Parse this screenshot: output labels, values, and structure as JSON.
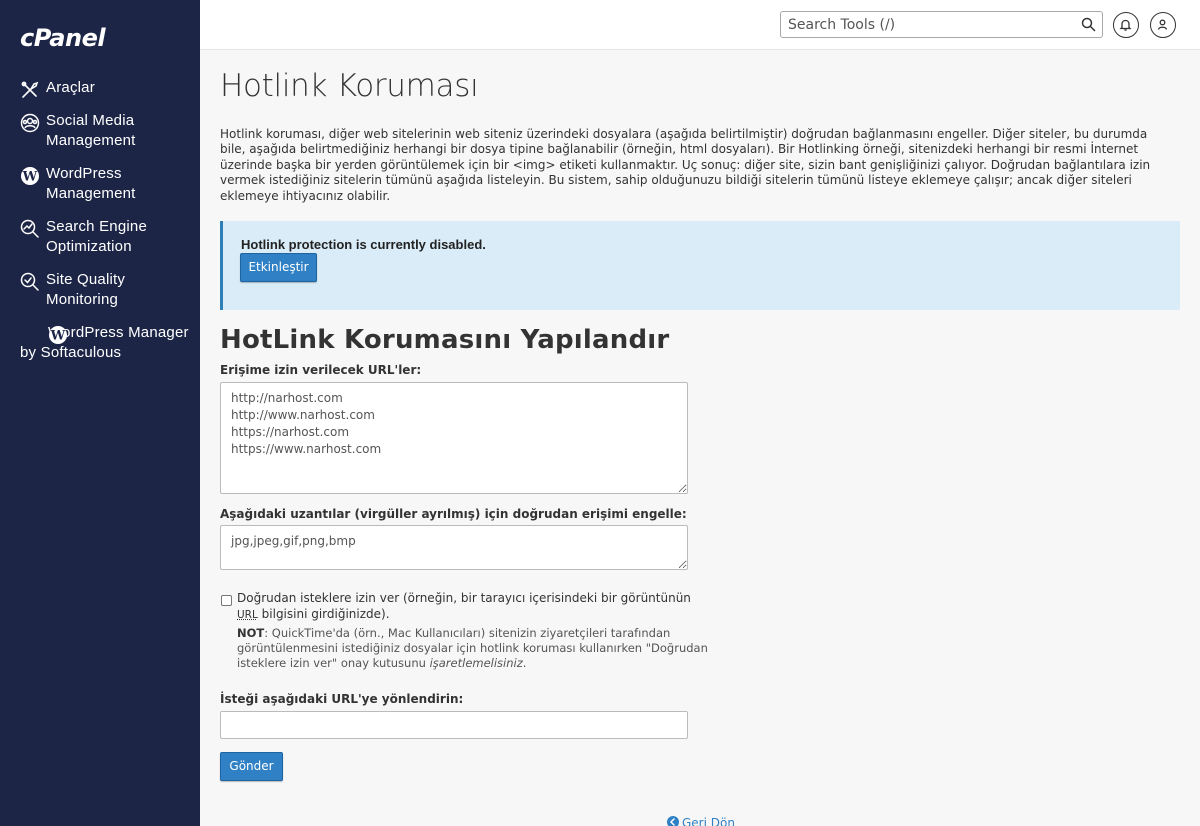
{
  "brand": {
    "logo_text": "cPanel"
  },
  "sidebar": {
    "items": [
      {
        "label": "Araçlar",
        "icon": "tools-icon"
      },
      {
        "label": "Social Media Management",
        "icon": "social-media-icon"
      },
      {
        "label": "WordPress Management",
        "icon": "wordpress-icon"
      },
      {
        "label": "Search Engine Optimization",
        "icon": "seo-chart-icon"
      },
      {
        "label": "Site Quality Monitoring",
        "icon": "magnifier-check-icon"
      },
      {
        "label": "WordPress Manager by Softaculous",
        "icon": "wordpress-icon"
      }
    ]
  },
  "header": {
    "search_placeholder": "Search Tools (/)",
    "notifications_icon": "bell-icon",
    "user_icon": "user-icon"
  },
  "page": {
    "title": "Hotlink Koruması",
    "description": "Hotlink koruması, diğer web sitelerinin web siteniz üzerindeki dosyalara (aşağıda belirtilmiştir) doğrudan bağlanmasını engeller. Diğer siteler, bu durumda bile, aşağıda belirtmediğiniz herhangi bir dosya tipine bağlanabilir (örneğin, html dosyaları). Bir Hotlinking örneği, sitenizdeki herhangi bir resmi İnternet üzerinde başka bir yerden görüntülemek için bir <img> etiketi kullanmaktır. Uç sonuç: diğer site, sizin bant genişliğinizi çalıyor. Doğrudan bağlantılara izin vermek istediğiniz sitelerin tümünü aşağıda listeleyin. Bu sistem, sahip olduğunuzu bildiği sitelerin tümünü listeye eklemeye çalışır; ancak diğer siteleri eklemeye ihtiyacınız olabilir."
  },
  "alert": {
    "status_text": "Hotlink protection is currently disabled.",
    "enable_button": "Etkinleştir"
  },
  "form": {
    "section_title": "HotLink Korumasını Yapılandır",
    "allowed_urls_label": "Erişime izin verilecek URL'ler:",
    "allowed_urls_value": "http://narhost.com\nhttp://www.narhost.com\nhttps://narhost.com\nhttps://www.narhost.com",
    "extensions_label": "Aşağıdaki uzantılar (virgüller ayrılmış) için doğrudan erişimi engelle:",
    "extensions_value": "jpg,jpeg,gif,png,bmp",
    "allow_direct_label_before": "Doğrudan isteklere izin ver (örneğin, bir tarayıcı içerisindeki bir görüntünün ",
    "allow_direct_label_abbr": "URL",
    "allow_direct_label_after": " bilgisini girdiğinizde).",
    "allow_direct_checked": false,
    "note_prefix": "NOT",
    "note_text": ": QuickTime'da (örn., Mac Kullanıcıları) sitenizin ziyaretçileri tarafından görüntülenmesini istediğiniz dosyalar için hotlink koruması kullanırken \"Doğrudan isteklere izin ver\" onay kutusunu ",
    "note_emphasis": "işaretlemelisiniz",
    "note_end": ".",
    "redirect_label": "İsteği aşağıdaki URL'ye yönlendirin:",
    "redirect_value": "",
    "submit_button": "Gönder"
  },
  "footer": {
    "back_link": "Geri Dön",
    "back_icon": "arrow-circle-left-icon"
  }
}
